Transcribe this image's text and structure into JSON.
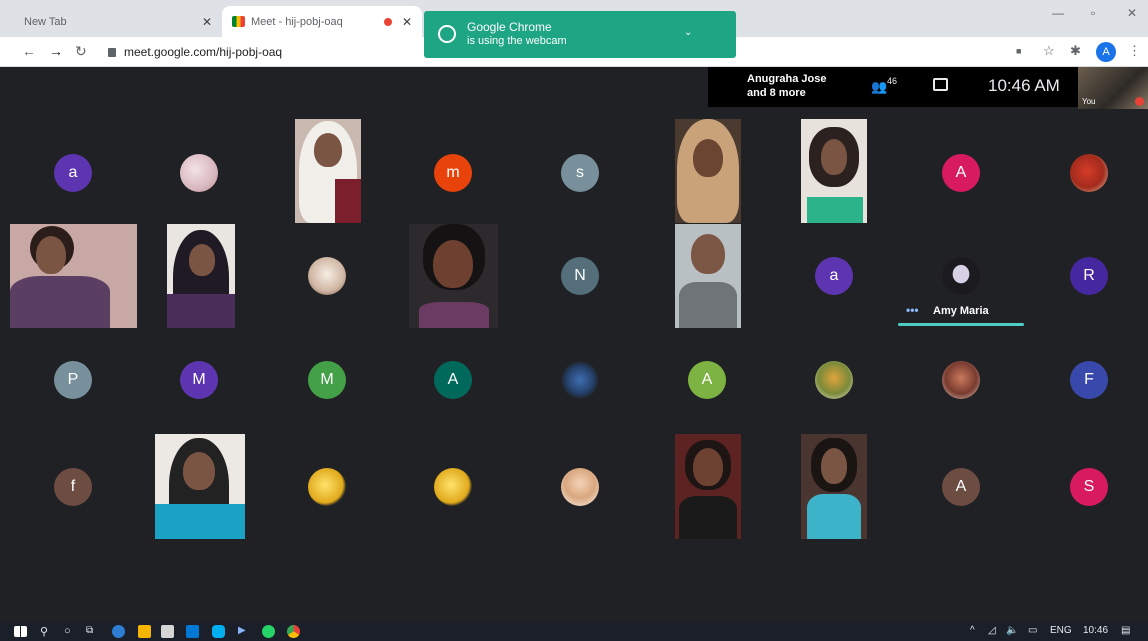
{
  "browser": {
    "tabs": [
      {
        "label": "New Tab"
      },
      {
        "label": "Meet - hij-pobj-oaq"
      }
    ],
    "url": "meet.google.com/hij-pobj-oaq",
    "profile_initial": "A"
  },
  "notification": {
    "title": "Google Chrome",
    "subtitle": "is using the webcam"
  },
  "meet": {
    "presenting": "Anugraha Jose and 8 more",
    "presenting_line1": "Anugraha Jose",
    "presenting_line2": "and 8 more",
    "participant_count": "46",
    "time": "10:46 AM",
    "self_label": "You",
    "active_speaker": "Amy Maria",
    "avatars": [
      {
        "letter": "a",
        "color": "#5e35b1"
      },
      {
        "letter": "m",
        "color": "#e8430b"
      },
      {
        "letter": "s",
        "color": "#78909c"
      },
      {
        "letter": "A",
        "color": "#d81b60"
      },
      {
        "letter": "N",
        "color": "#546e7a"
      },
      {
        "letter": "a",
        "color": "#5e35b1"
      },
      {
        "letter": "R",
        "color": "#4527a0"
      },
      {
        "letter": "P",
        "color": "#78909c"
      },
      {
        "letter": "M",
        "color": "#5e35b1"
      },
      {
        "letter": "M",
        "color": "#43a047"
      },
      {
        "letter": "A",
        "color": "#00695c"
      },
      {
        "letter": "A",
        "color": "#7cb342"
      },
      {
        "letter": "F",
        "color": "#3949ab"
      },
      {
        "letter": "f",
        "color": "#6d4c41"
      },
      {
        "letter": "A",
        "color": "#6d4c41"
      },
      {
        "letter": "S",
        "color": "#d81b60"
      }
    ]
  },
  "taskbar": {
    "language": "ENG",
    "time": "10:46"
  }
}
